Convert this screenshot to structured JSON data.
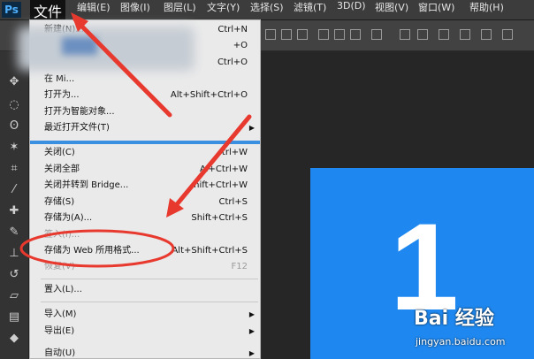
{
  "menubar": {
    "logo": "Ps",
    "items": [
      "文件",
      "编辑(E)",
      "图像(I)",
      "图层(L)",
      "文字(Y)",
      "选择(S)",
      "滤镜(T)",
      "3D(D)",
      "视图(V)",
      "窗口(W)",
      "帮助(H)"
    ]
  },
  "file_menu": {
    "items": [
      {
        "label": "新建(N)...",
        "shortcut": "Ctrl+N"
      },
      {
        "label": "",
        "shortcut": "+O"
      },
      {
        "label": "",
        "shortcut": "Ctrl+O"
      },
      {
        "label": "在 Mi...",
        "shortcut": ""
      },
      {
        "label": "打开为...",
        "shortcut": "Alt+Shift+Ctrl+O"
      },
      {
        "label": "打开为智能对象...",
        "shortcut": ""
      },
      {
        "label": "最近打开文件(T)",
        "shortcut": ""
      },
      {
        "label": "关闭(C)",
        "shortcut": "trl+W"
      },
      {
        "label": "关闭全部",
        "shortcut": "Al+Ctrl+W"
      },
      {
        "label": "关闭并转到 Bridge...",
        "shortcut": "hift+Ctrl+W"
      },
      {
        "label": "存储(S)",
        "shortcut": "Ctrl+S"
      },
      {
        "label": "存储为(A)...",
        "shortcut": "Shift+Ctrl+S"
      },
      {
        "label": "签入(I)...",
        "shortcut": ""
      },
      {
        "label": "存储为 Web 所用格式...",
        "shortcut": "Alt+Shift+Ctrl+S"
      },
      {
        "label": "恢复(V)",
        "shortcut": "F12"
      },
      {
        "label": "置入(L)...",
        "shortcut": ""
      },
      {
        "label": "导入(M)",
        "shortcut": ""
      },
      {
        "label": "导出(E)",
        "shortcut": ""
      },
      {
        "label": "自动(U)",
        "shortcut": ""
      }
    ]
  },
  "canvas": {
    "big_text": "1",
    "doc_color": "#1e88f0"
  },
  "watermark": {
    "brand": "Bai 经验",
    "url": "jingyan.baidu.com"
  },
  "annotation_color": "#e8392f",
  "icons": {
    "submenu": "chevron-right-icon"
  }
}
